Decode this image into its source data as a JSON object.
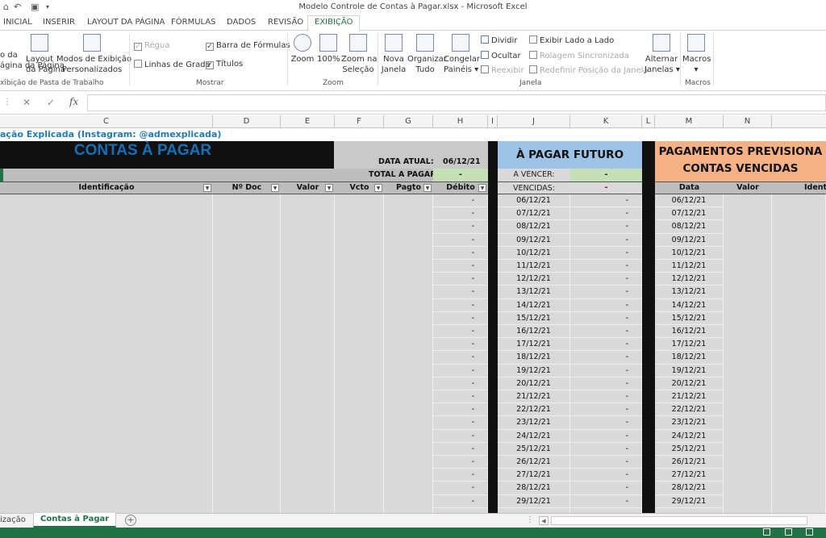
{
  "window": {
    "title": "Modelo Controle de Contas à Pagar.xlsx - Microsoft Excel"
  },
  "tabs": [
    "INICIAL",
    "INSERIR",
    "LAYOUT DA PÁGINA",
    "FÓRMULAS",
    "DADOS",
    "REVISÃO",
    "EXIBIÇÃO"
  ],
  "ribbon": {
    "normal": "o da\nágina da Página",
    "layout": "Layout\nda Página",
    "custom": "Modos de Exibição\nPersonalizados",
    "group1": "xibição de Pasta de Trabalho",
    "regua": "Régua",
    "linhas": "Linhas de Grade",
    "barra": "Barra de Fórmulas",
    "titulos": "Títulos",
    "group2": "Mostrar",
    "zoom": "Zoom",
    "z100": "100%",
    "zoomsel": "Zoom na\nSeleção",
    "group3": "Zoom",
    "nova": "Nova\nJanela",
    "organizar": "Organizar\nTudo",
    "congelar": "Congelar\nPainéis ▾",
    "dividir": "Dividir",
    "ocultar": "Ocultar",
    "reexibir": "Reexibir",
    "lado": "Exibir Lado a Lado",
    "rolagem": "Rolagem Sincronizada",
    "redefinir": "Redefinir Posição da Janela",
    "alternar": "Alternar\nJanelas ▾",
    "group4": "Janela",
    "macros": "Macros\n▾",
    "group5": "Macros"
  },
  "formula_bar": {
    "fx": "fx",
    "cancel": "✕",
    "enter": "✓"
  },
  "columns": [
    "C",
    "D",
    "E",
    "F",
    "G",
    "H",
    "I",
    "J",
    "K",
    "L",
    "M",
    "N"
  ],
  "sheet": {
    "credit": "ação Explicada (Instagram: @admexplicada)",
    "title": "CONTAS À PAGAR",
    "data_atual_label": "DATA ATUAL:",
    "data_atual": "06/12/21",
    "total_label": "TOTAL A PAGAR",
    "total_value": "-",
    "headers": [
      "Identificação",
      "Nº Doc",
      "Valor",
      "Vcto",
      "Pagto",
      "Débito"
    ],
    "debito_values": "-",
    "futuro_title": "À PAGAR FUTURO",
    "a_vencer_label": "A VENCER:",
    "a_vencer_value": "-",
    "vencidas_label": "VENCIDAS:",
    "vencidas_value": "-",
    "prev_title_1": "PAGAMENTOS PREVISIONA",
    "prev_title_2": "CONTAS VENCIDAS",
    "prev_headers": [
      "Data",
      "Valor",
      "Ident"
    ],
    "dates": [
      "06/12/21",
      "07/12/21",
      "08/12/21",
      "09/12/21",
      "10/12/21",
      "11/12/21",
      "12/12/21",
      "13/12/21",
      "14/12/21",
      "15/12/21",
      "16/12/21",
      "17/12/21",
      "18/12/21",
      "19/12/21",
      "20/12/21",
      "21/12/21",
      "22/12/21",
      "23/12/21",
      "24/12/21",
      "25/12/21",
      "26/12/21",
      "27/12/21",
      "28/12/21",
      "29/12/21"
    ]
  },
  "sheet_tabs": {
    "prev": "ização",
    "active": "Contas à Pagar",
    "add": "+"
  },
  "colors": {
    "excel_green": "#217346",
    "blue_header": "#9dc3e6",
    "orange_header": "#f4b183",
    "green_total": "#c5e0b4",
    "title_blue": "#1470b8"
  }
}
